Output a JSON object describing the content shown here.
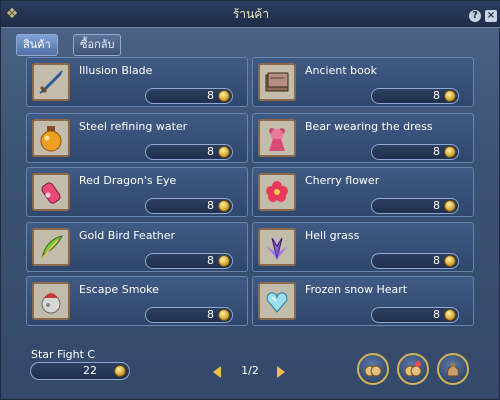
{
  "window": {
    "title": "ร้านค้า"
  },
  "tabs": [
    {
      "label": "สินค้า",
      "active": true
    },
    {
      "label": "ซื้อกลับ",
      "active": false
    }
  ],
  "items": [
    {
      "name": "Illusion Blade",
      "price": "8",
      "icon": "sword-icon"
    },
    {
      "name": "Ancient book",
      "price": "8",
      "icon": "book-icon"
    },
    {
      "name": "Steel refining water",
      "price": "8",
      "icon": "potion-jar-icon"
    },
    {
      "name": "Bear wearing the dress",
      "price": "8",
      "icon": "bear-doll-icon"
    },
    {
      "name": "Red Dragon's Eye",
      "price": "8",
      "icon": "red-potion-icon"
    },
    {
      "name": "Cherry flower",
      "price": "8",
      "icon": "flower-icon"
    },
    {
      "name": "Gold Bird Feather",
      "price": "8",
      "icon": "feather-icon"
    },
    {
      "name": "Hell grass",
      "price": "8",
      "icon": "grass-icon"
    },
    {
      "name": "Escape Smoke",
      "price": "8",
      "icon": "smoke-bomb-icon"
    },
    {
      "name": "Frozen snow Heart",
      "price": "8",
      "icon": "heart-crystal-icon"
    }
  ],
  "currency": {
    "label": "Star Fight C",
    "value": "22",
    "icon": "coin-icon"
  },
  "pager": {
    "text": "1/2"
  },
  "actions": [
    {
      "icon": "buy-bag-icon"
    },
    {
      "icon": "sell-bag-icon"
    },
    {
      "icon": "repair-bag-icon"
    }
  ],
  "colors": {
    "panel": "#34496a",
    "card": "#3f5a84",
    "border": "#6684b0",
    "gold": "#e8c04a"
  }
}
